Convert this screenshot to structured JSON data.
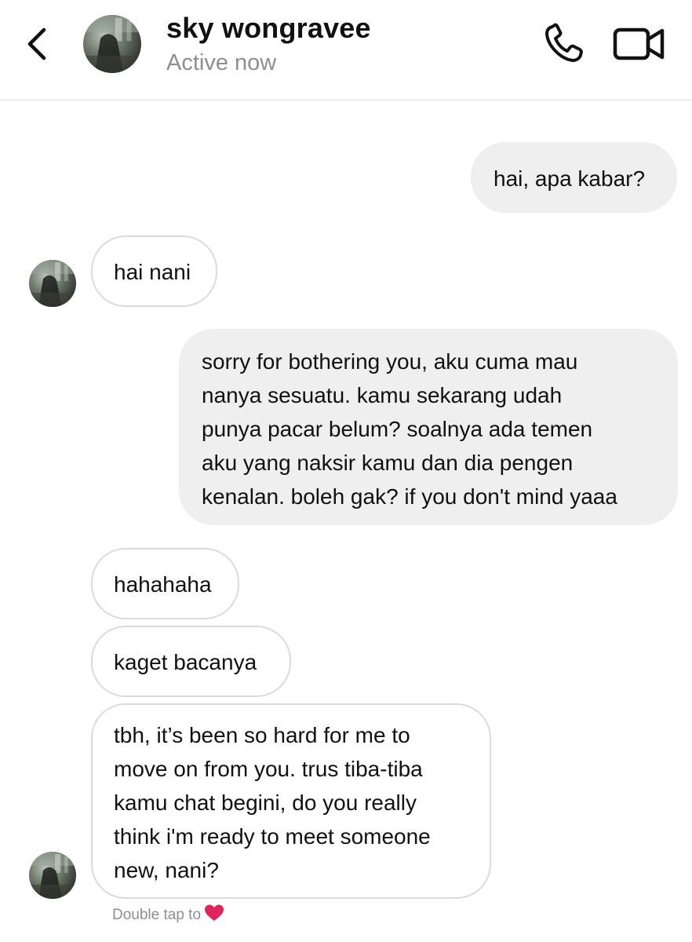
{
  "header": {
    "contact_name": "sky wongravee",
    "status": "Active now",
    "back_icon": "chevron-left-icon",
    "call_icon": "phone-icon",
    "video_icon": "video-camera-icon"
  },
  "messages": [
    {
      "direction": "outgoing",
      "lines": [
        "hai, apa kabar?"
      ]
    },
    {
      "direction": "incoming",
      "lines": [
        "hai nani"
      ]
    },
    {
      "direction": "outgoing",
      "lines": [
        "sorry for bothering you, aku cuma mau",
        "nanya sesuatu. kamu sekarang udah",
        "punya pacar belum? soalnya ada temen",
        "aku yang naksir kamu dan dia pengen",
        "kenalan. boleh gak? if you don't mind yaaa"
      ]
    },
    {
      "direction": "incoming",
      "lines": [
        "hahahaha"
      ]
    },
    {
      "direction": "incoming",
      "lines": [
        "kaget bacanya"
      ]
    },
    {
      "direction": "incoming",
      "lines": [
        "tbh, it’s been so hard for me to",
        "move on from you. trus tiba-tiba",
        "kamu chat begini, do you really",
        "think i'm ready to meet someone",
        "new, nani?"
      ]
    }
  ],
  "footer": {
    "hint_text": "Double tap to",
    "hint_icon": "heart-icon"
  },
  "colors": {
    "outgoing_bubble": "#efefef",
    "incoming_border": "#dbdbdb",
    "secondary_text": "#8e8e8e",
    "heart": "#e0245e"
  }
}
